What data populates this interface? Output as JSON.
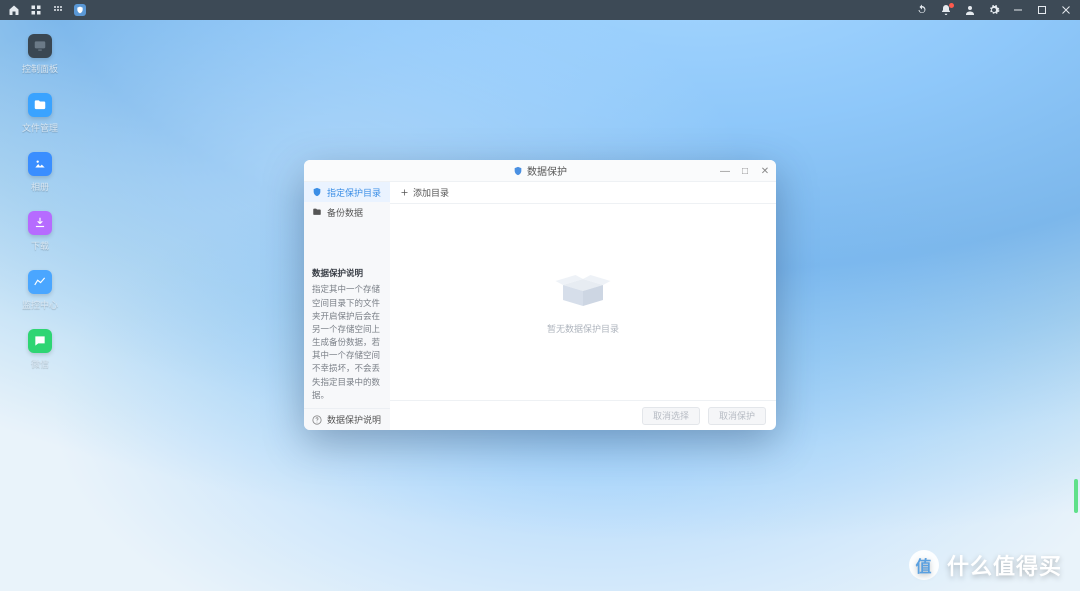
{
  "taskbar": {
    "left_icons": [
      "home",
      "apps",
      "grid",
      "shield-active"
    ],
    "right_icons": [
      "sync",
      "bell",
      "user",
      "settings",
      "minimize",
      "maximize",
      "close"
    ]
  },
  "desktop_icons": [
    {
      "label": "控制面板",
      "color": "#3a4752",
      "svg": "monitor"
    },
    {
      "label": "文件管理",
      "color": "#3aa3ff",
      "svg": "folder"
    },
    {
      "label": "相册",
      "color": "#3a8eff",
      "svg": "photo"
    },
    {
      "label": "下载",
      "color": "#b66bff",
      "svg": "download"
    },
    {
      "label": "监控中心",
      "color": "#4aa6ff",
      "svg": "chart"
    },
    {
      "label": "微信",
      "color": "#2ed573",
      "svg": "chat"
    }
  ],
  "dialog": {
    "title": "数据保护",
    "ctrls": {
      "min": "—",
      "max": "□",
      "close": "✕"
    },
    "sidebar": {
      "items": [
        {
          "label": "指定保护目录",
          "icon": "shield",
          "active": true
        },
        {
          "label": "备份数据",
          "icon": "folder",
          "active": false
        }
      ],
      "help_title": "数据保护说明",
      "help_body": "指定其中一个存储空间目录下的文件夹开启保护后会在另一个存储空间上生成备份数据，若其中一个存储空间不幸损坏，不会丢失指定目录中的数据。",
      "help_link": "数据保护说明"
    },
    "toolbar": {
      "add_label": "添加目录"
    },
    "empty_text": "暂无数据保护目录",
    "footer": {
      "btn1": "取消选择",
      "btn2": "取消保护"
    }
  },
  "watermark": "什么值得买",
  "watermark_badge": "值"
}
